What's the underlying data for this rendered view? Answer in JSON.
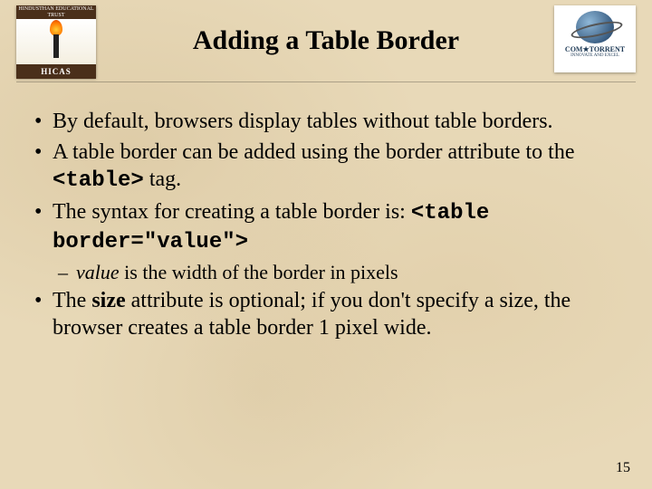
{
  "header": {
    "title": "Adding a Table Border",
    "logo_left": {
      "top_text": "HINDUSTHAN EDUCATIONAL TRUST",
      "bottom_text": "HICAS"
    },
    "logo_right": {
      "brand": "COM★TORRENT",
      "tagline": "INNOVATE AND EXCEL"
    }
  },
  "bullets": {
    "b1": "By default, browsers display tables without table borders.",
    "b2_pre": "A table border can be added using the border attribute to the ",
    "b2_code": "<table>",
    "b2_post": " tag.",
    "b3_pre": "The syntax for creating a table border is: ",
    "b3_code": "<table border=\"value\">",
    "sub_value_word": "value",
    "sub_rest": " is the width of the border in pixels",
    "b4_pre": "The ",
    "b4_bold": "size",
    "b4_post": " attribute is optional; if you don't specify a size, the browser creates a table border 1 pixel wide."
  },
  "page_number": "15"
}
